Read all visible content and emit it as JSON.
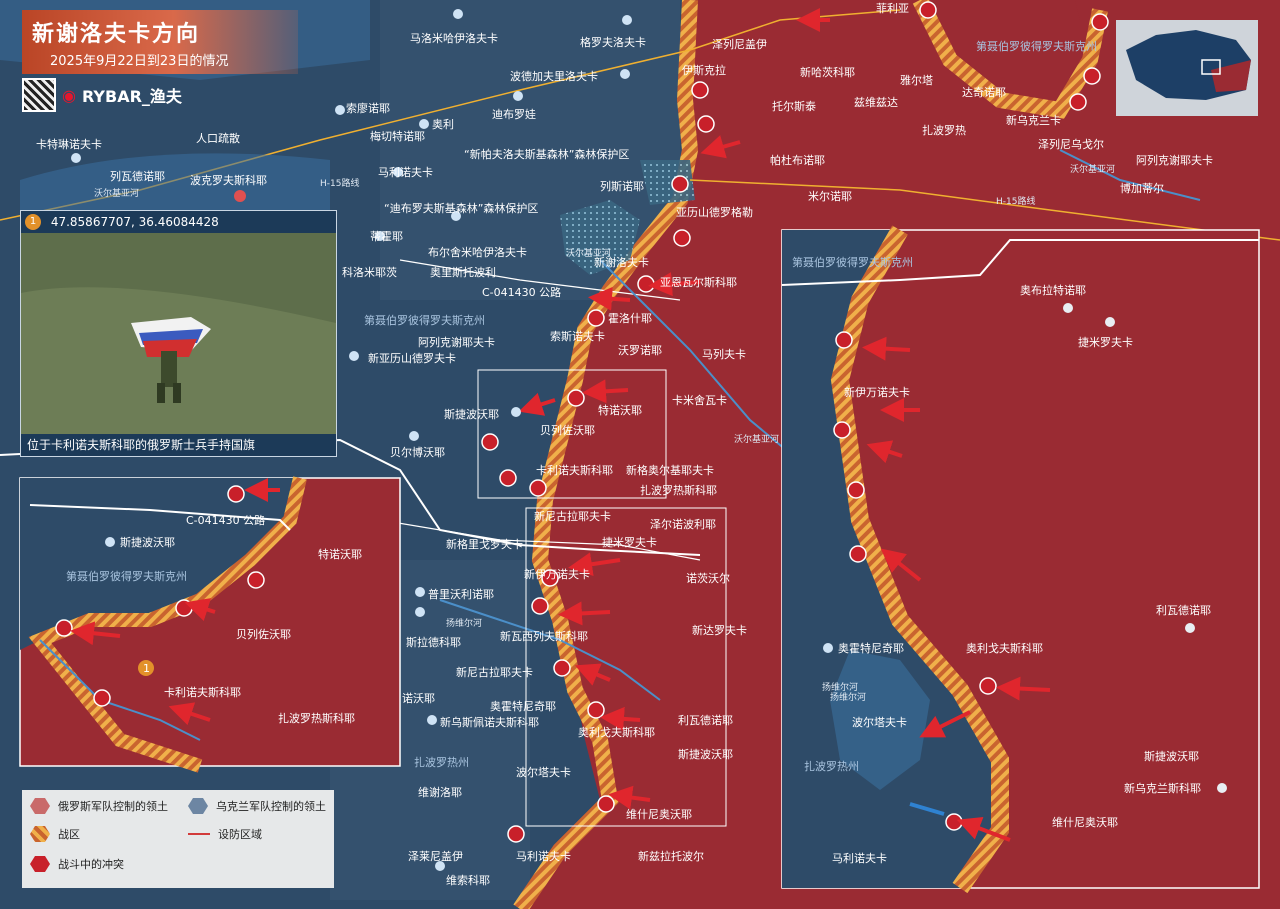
{
  "header": {
    "title": "新谢洛夫卡方向",
    "subtitle": "2025年9月22日到23日的情况"
  },
  "brand": {
    "name": "RYBAR_渔夫"
  },
  "photo": {
    "marker_number": "1",
    "coordinates": "47.85867707, 36.46084428",
    "caption": "位于卡利诺夫斯科耶的俄罗斯士兵手持国旗"
  },
  "legend": {
    "russian_control": "俄罗斯军队控制的领土",
    "ukrainian_control": "乌克兰军队控制的领土",
    "combat_zone": "战区",
    "fortified_area": "设防区域",
    "fighting": "战斗中的冲突"
  },
  "colors": {
    "russian": "#9a2b33",
    "ukrainian": "#2e4b68",
    "frontline": "#e8a33c",
    "arrow": "#e0262d",
    "counter_arrow": "#2f82d1"
  },
  "map": {
    "top_villages": [
      "马洛米哈伊洛夫卡",
      "格罗夫洛夫卡",
      "菲利亚",
      "泽列尼盖伊",
      "伊斯克拉",
      "新哈茨科耶",
      "波德加夫里洛夫卡",
      "索廖诺耶",
      "奥利",
      "迪布罗娃",
      "梅切特诺耶",
      "雅尔塔",
      "达奇诺耶",
      "托尔斯泰",
      "兹维兹达",
      "扎波罗热",
      "新乌克兰卡",
      "卡特琳诺夫卡",
      "列瓦德诺耶",
      "波克罗夫斯科耶",
      "马利诺夫卡",
      "帕杜布诺耶",
      "泽列尼乌戈尔",
      "阿列克谢耶夫卡",
      "米尔诺耶",
      "博加蒂尔",
      "列斯诺耶",
      "亚历山德罗格勒"
    ],
    "middle_villages": [
      "蒂霍耶",
      "布尔舍米哈伊洛夫卡",
      "科洛米耶茨",
      "奥里斯托波利",
      "新谢洛夫卡",
      "亚恩瓦尔斯科耶",
      "索斯诺夫卡",
      "霍洛什耶",
      "沃罗诺耶",
      "阿列克谢耶夫卡",
      "新亚历山德罗夫卡",
      "马列夫卡",
      "斯捷波沃耶",
      "特诺沃耶",
      "贝列佐沃耶",
      "卡米舍瓦卡",
      "贝尔博沃耶",
      "卡利诺夫斯科耶",
      "新格奥尔基耶夫卡",
      "扎波罗热斯科耶"
    ],
    "bottom_villages": [
      "新尼古拉耶夫卡",
      "泽尔诺波利耶",
      "新格里戈罗夫卡",
      "捷米罗夫卡",
      "新伊万诺夫卡",
      "诺茨沃尔",
      "普里沃利诺耶",
      "新达罗夫卡",
      "斯拉德科耶",
      "新瓦西列夫斯科耶",
      "新尼古拉耶夫卡",
      "诺沃耶",
      "奥霍特尼奇耶",
      "奥利戈夫斯科耶",
      "利瓦德诺耶",
      "新乌斯佩诺夫斯科耶",
      "斯捷波沃耶",
      "扎波罗热州",
      "波尔塔夫卡",
      "维谢洛耶",
      "维什尼奥沃耶",
      "泽莱尼盖伊",
      "马利诺夫卡",
      "新兹拉托波尔",
      "维索科耶"
    ],
    "labels": {
      "evacuation": "人口疏散",
      "forest1": "“新帕夫洛夫斯基森林”森林保护区",
      "forest2": "“迪布罗夫斯基森林”森林保护区",
      "road_c": "C-041430 公路",
      "road_h15": "H-15路线",
      "road_h15_b": "H-15路线",
      "dnipro_region": "第聂伯罗彼得罗夫斯克州",
      "zaporizhzhia_region": "扎波罗热州",
      "river_1": "沃尔基亚河",
      "river_2": "沃尔基亚河",
      "river_3": "沃尔基亚河",
      "river_4": "沃尔基亚河",
      "river_5": "扬维尔河",
      "river_6": "扬维尔河"
    }
  },
  "inset_left": {
    "road": "C-041430 公路",
    "region": "第聂伯罗彼得罗夫斯克州",
    "villages": [
      "斯捷波沃耶",
      "特诺沃耶",
      "贝列佐沃耶",
      "卡利诺夫斯科耶",
      "扎波罗热斯科耶"
    ],
    "marker_number": "1"
  },
  "inset_right": {
    "region": "第聂伯罗彼得罗夫斯克州",
    "zaporizhzhia": "扎波罗热州",
    "river": "扬维尔河",
    "villages": [
      "奥布拉特诺耶",
      "捷米罗夫卡",
      "新伊万诺夫卡",
      "利瓦德诺耶",
      "奥霍特尼奇耶",
      "奥利戈夫斯科耶",
      "波尔塔夫卡",
      "斯捷波沃耶",
      "新乌克兰斯科耶",
      "维什尼奥沃耶",
      "马利诺夫卡"
    ]
  }
}
